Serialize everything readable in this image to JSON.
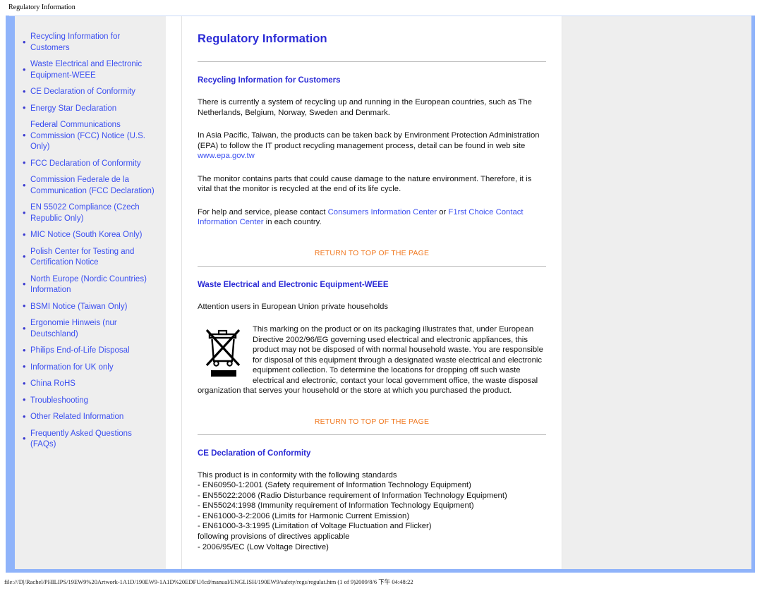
{
  "browser": {
    "page_title": "Regulatory Information",
    "status_text": "file:///D|/Rachel/PHILIPS/19EW9%20Artwork-1A1D/190EW9-1A1D%20EDFU/lcd/manual/ENGLISH/190EW9/safety/regs/regulat.htm (1 of 9)2009/8/6 下午 04:48:22"
  },
  "colors": {
    "link_blue": "#3b4ff0",
    "heading_blue": "#2b2bd6",
    "return_orange": "#f07820",
    "frame_blue": "#8fb3fa",
    "sidebar_gray": "#eeeeee"
  },
  "sidebar": {
    "items": [
      {
        "label": "Recycling Information for Customers"
      },
      {
        "label": "Waste Electrical and Electronic Equipment-WEEE"
      },
      {
        "label": "CE Declaration of Conformity"
      },
      {
        "label": "Energy Star Declaration"
      },
      {
        "label": "Federal Communications Commission (FCC) Notice (U.S. Only)"
      },
      {
        "label": "FCC Declaration of Conformity"
      },
      {
        "label": "Commission Federale de la Communication (FCC Declaration)"
      },
      {
        "label": "EN 55022 Compliance (Czech Republic Only)"
      },
      {
        "label": "MIC Notice (South Korea Only)"
      },
      {
        "label": "Polish Center for Testing and Certification Notice"
      },
      {
        "label": "North Europe (Nordic Countries) Information"
      },
      {
        "label": "BSMI Notice (Taiwan Only)"
      },
      {
        "label": "Ergonomie Hinweis (nur Deutschland)"
      },
      {
        "label": "Philips End-of-Life Disposal"
      },
      {
        "label": "Information for UK only"
      },
      {
        "label": "China RoHS"
      },
      {
        "label": "Troubleshooting"
      },
      {
        "label": "Other Related Information"
      },
      {
        "label": "Frequently Asked Questions (FAQs)"
      }
    ]
  },
  "main": {
    "title": "Regulatory Information",
    "return_to_top_label": "RETURN TO TOP OF THE PAGE",
    "recycling": {
      "heading": "Recycling Information for Customers",
      "p1": "There is currently a system of recycling up and running in the European countries, such as The Netherlands, Belgium, Norway, Sweden and Denmark.",
      "p2_before": "In Asia Pacific, Taiwan, the products can be taken back by Environment Protection Administration (EPA) to follow the IT product recycling management process, detail can be found in web site ",
      "p2_link": "www.epa.gov.tw",
      "p3": "The monitor contains parts that could cause damage to the nature environment. Therefore, it is vital that the monitor is recycled at the end of its life cycle.",
      "p4_before": "For help and service, please contact ",
      "p4_link1": "Consumers Information Center",
      "p4_mid": " or ",
      "p4_link2": "F1rst Choice Contact Information Center",
      "p4_after": " in each country."
    },
    "weee": {
      "heading": "Waste Electrical and Electronic Equipment-WEEE",
      "intro": "Attention users in European Union private households",
      "icon_name": "crossed-out-wheelie-bin-icon",
      "body": "This marking on the product or on its packaging illustrates that, under European Directive 2002/96/EG governing used electrical and electronic appliances, this product may not be disposed of with normal household waste. You are responsible for disposal of this equipment through a designated waste electrical and electronic equipment collection. To determine the locations for dropping off such waste electrical and electronic, contact your local government office, the waste disposal organization that serves your household or the store at which you purchased the product."
    },
    "ce": {
      "heading": "CE Declaration of Conformity",
      "lines": [
        "This product is in conformity with the following standards",
        "- EN60950-1:2001 (Safety requirement of Information Technology Equipment)",
        "- EN55022:2006 (Radio Disturbance requirement of Information Technology Equipment)",
        "- EN55024:1998 (Immunity requirement of Information Technology Equipment)",
        "- EN61000-3-2:2006 (Limits for Harmonic Current Emission)",
        "- EN61000-3-3:1995 (Limitation of Voltage Fluctuation and Flicker)",
        "following provisions of directives applicable",
        "- 2006/95/EC (Low Voltage Directive)"
      ]
    }
  }
}
